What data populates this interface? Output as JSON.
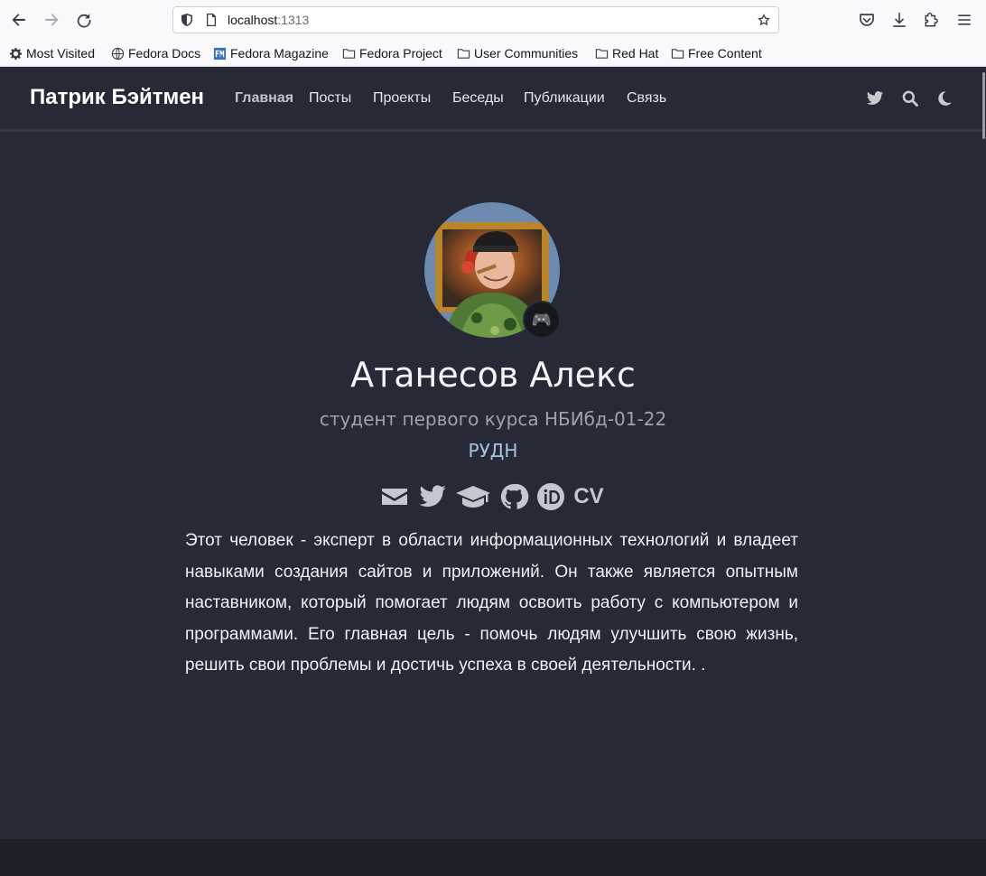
{
  "browser": {
    "url_host": "localhost",
    "url_port": ":1313",
    "bookmarks": [
      {
        "label": "Most Visited",
        "icon": "gear-icon"
      },
      {
        "label": "Fedora Docs",
        "icon": "globe-icon"
      },
      {
        "label": "Fedora Magazine",
        "icon": "fedora-magazine-icon"
      },
      {
        "label": "Fedora Project",
        "icon": "folder-icon"
      },
      {
        "label": "User Communities",
        "icon": "folder-icon"
      },
      {
        "label": "Red Hat",
        "icon": "folder-icon"
      },
      {
        "label": "Free Content",
        "icon": "folder-icon"
      }
    ]
  },
  "site": {
    "brand": "Патрик Бэйтмен",
    "nav": [
      "Главная",
      "Посты",
      "Проекты",
      "Беседы",
      "Публикации",
      "Связь"
    ],
    "active_nav": "Главная",
    "nav_icons": [
      "twitter-icon",
      "search-icon",
      "moon-icon"
    ]
  },
  "profile": {
    "name": "Атанесов Алекс",
    "role": "студент первого курса НБИбд-01-22",
    "organization": "РУДН",
    "badge_emoji": "🎮",
    "social_icons": [
      "envelope-icon",
      "twitter-icon",
      "graduation-cap-icon",
      "github-icon",
      "orcid-icon",
      "cv-icon"
    ],
    "cv_label": "CV",
    "bio": "Этот человек - эксперт в области информационных технологий и владеет навыками создания сайтов и приложений. Он также является опытным наставником, который помогает людям освоить работу с компьютером и программами. Его главная цель - помочь людям улучшить свою жизнь, решить свои проблемы и достичь успеха в своей деятельности. ."
  },
  "colors": {
    "page_bg": "#272a36",
    "accent_org": "#a7c4dc",
    "chrome_bg": "#f9f9fb"
  }
}
